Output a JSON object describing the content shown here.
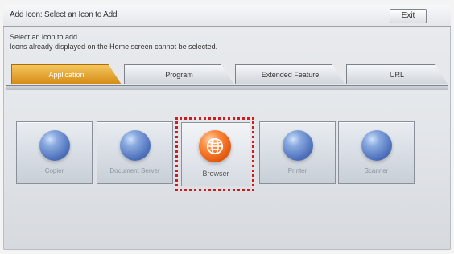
{
  "window": {
    "title": "Add Icon: Select an Icon to Add",
    "exit_label": "Exit"
  },
  "instructions": {
    "line1": "Select an icon to add.",
    "line2": "Icons already displayed on the Home screen cannot be selected."
  },
  "tabs": [
    {
      "label": "Application",
      "active": true
    },
    {
      "label": "Program",
      "active": false
    },
    {
      "label": "Extended Feature",
      "active": false
    },
    {
      "label": "URL",
      "active": false
    }
  ],
  "icons": [
    {
      "label": "Copier",
      "icon": "sphere-icon",
      "state": "disabled"
    },
    {
      "label": "Document Server",
      "icon": "sphere-icon",
      "state": "disabled"
    },
    {
      "label": "Browser",
      "icon": "globe-icon",
      "state": "selected"
    },
    {
      "label": "Printer",
      "icon": "sphere-icon",
      "state": "disabled"
    },
    {
      "label": "Scanner",
      "icon": "sphere-icon",
      "state": "disabled"
    }
  ],
  "colors": {
    "active_tab": "#d58a14",
    "selection_border": "#cc1c1c",
    "browser_icon": "#e45b12",
    "disabled_icon": "#3e63b6"
  }
}
